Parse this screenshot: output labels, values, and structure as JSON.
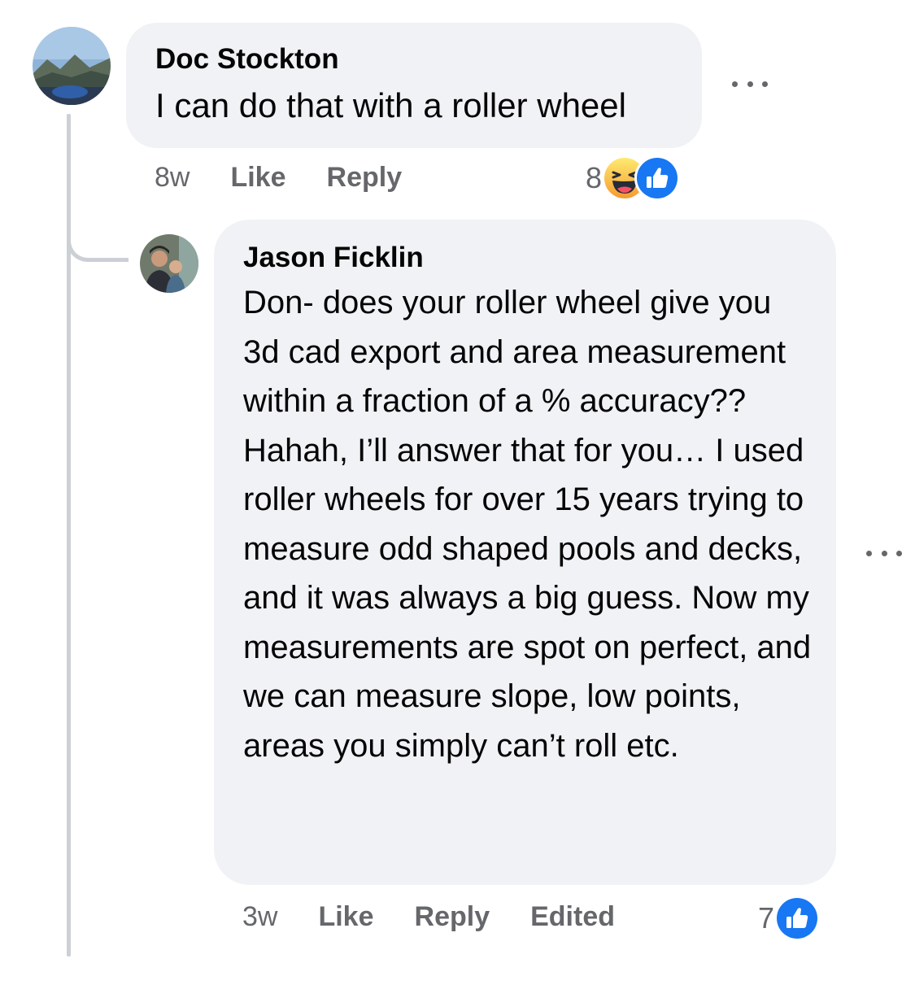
{
  "comments": [
    {
      "author": "Doc Stockton",
      "text": "I can do that with a roller wheel",
      "time": "8w",
      "like_label": "Like",
      "reply_label": "Reply",
      "reaction_count": "8",
      "reactions": [
        "haha-icon",
        "like-icon"
      ],
      "avatar_icon": "landscape-avatar"
    },
    {
      "author": "Jason Ficklin",
      "text": "Don- does your roller wheel give you 3d cad export and area measurement within a fraction of a % accuracy?? Hahah, I’ll answer that for you… I used roller wheels for over 15 years trying to measure odd shaped pools and decks, and it was always a big guess. Now my measurements are spot on perfect, and we can measure slope, low points, areas you simply can’t roll etc.",
      "time": "3w",
      "like_label": "Like",
      "reply_label": "Reply",
      "edited_label": "Edited",
      "reaction_count": "7",
      "reactions": [
        "like-icon"
      ],
      "avatar_icon": "person-photo-avatar"
    }
  ],
  "colors": {
    "bubble_bg": "#f0f2f5",
    "meta_text": "#65676b",
    "like_blue": "#1877f2",
    "haha_yellow": "#f7b928"
  }
}
